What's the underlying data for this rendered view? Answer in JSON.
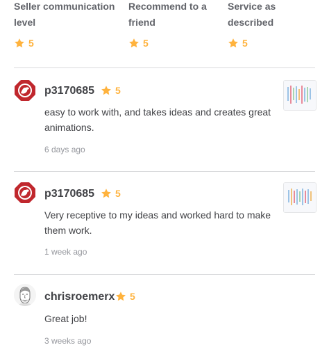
{
  "summary": {
    "items": [
      {
        "label_line1": "Seller communication",
        "label_line2": "level",
        "value": "5"
      },
      {
        "label_line1": "Recommend to a",
        "label_line2": "friend",
        "value": "5"
      },
      {
        "label_line1": "Service as",
        "label_line2": "described",
        "value": "5"
      }
    ]
  },
  "reviews": [
    {
      "username": "p3170685",
      "rating": "5",
      "comment": "easy to work with, and takes ideas and creates great animations.",
      "time": "6 days ago",
      "avatar": "logo-avatar",
      "has_thumbnail": true
    },
    {
      "username": "p3170685",
      "rating": "5",
      "comment": "Very receptive to my ideas and worked hard to make them work.",
      "time": "1 week ago",
      "avatar": "logo-avatar",
      "has_thumbnail": true
    },
    {
      "username": "chrisroemerx",
      "rating": "5",
      "comment": "Great job!",
      "time": "3 weeks ago",
      "avatar": "sketch-face-avatar",
      "has_thumbnail": false
    }
  ],
  "colors": {
    "star": "#ffb33e",
    "text": "#404145",
    "muted": "#95979d",
    "divider": "#dadbdd",
    "logo_red": "#c0272d"
  }
}
